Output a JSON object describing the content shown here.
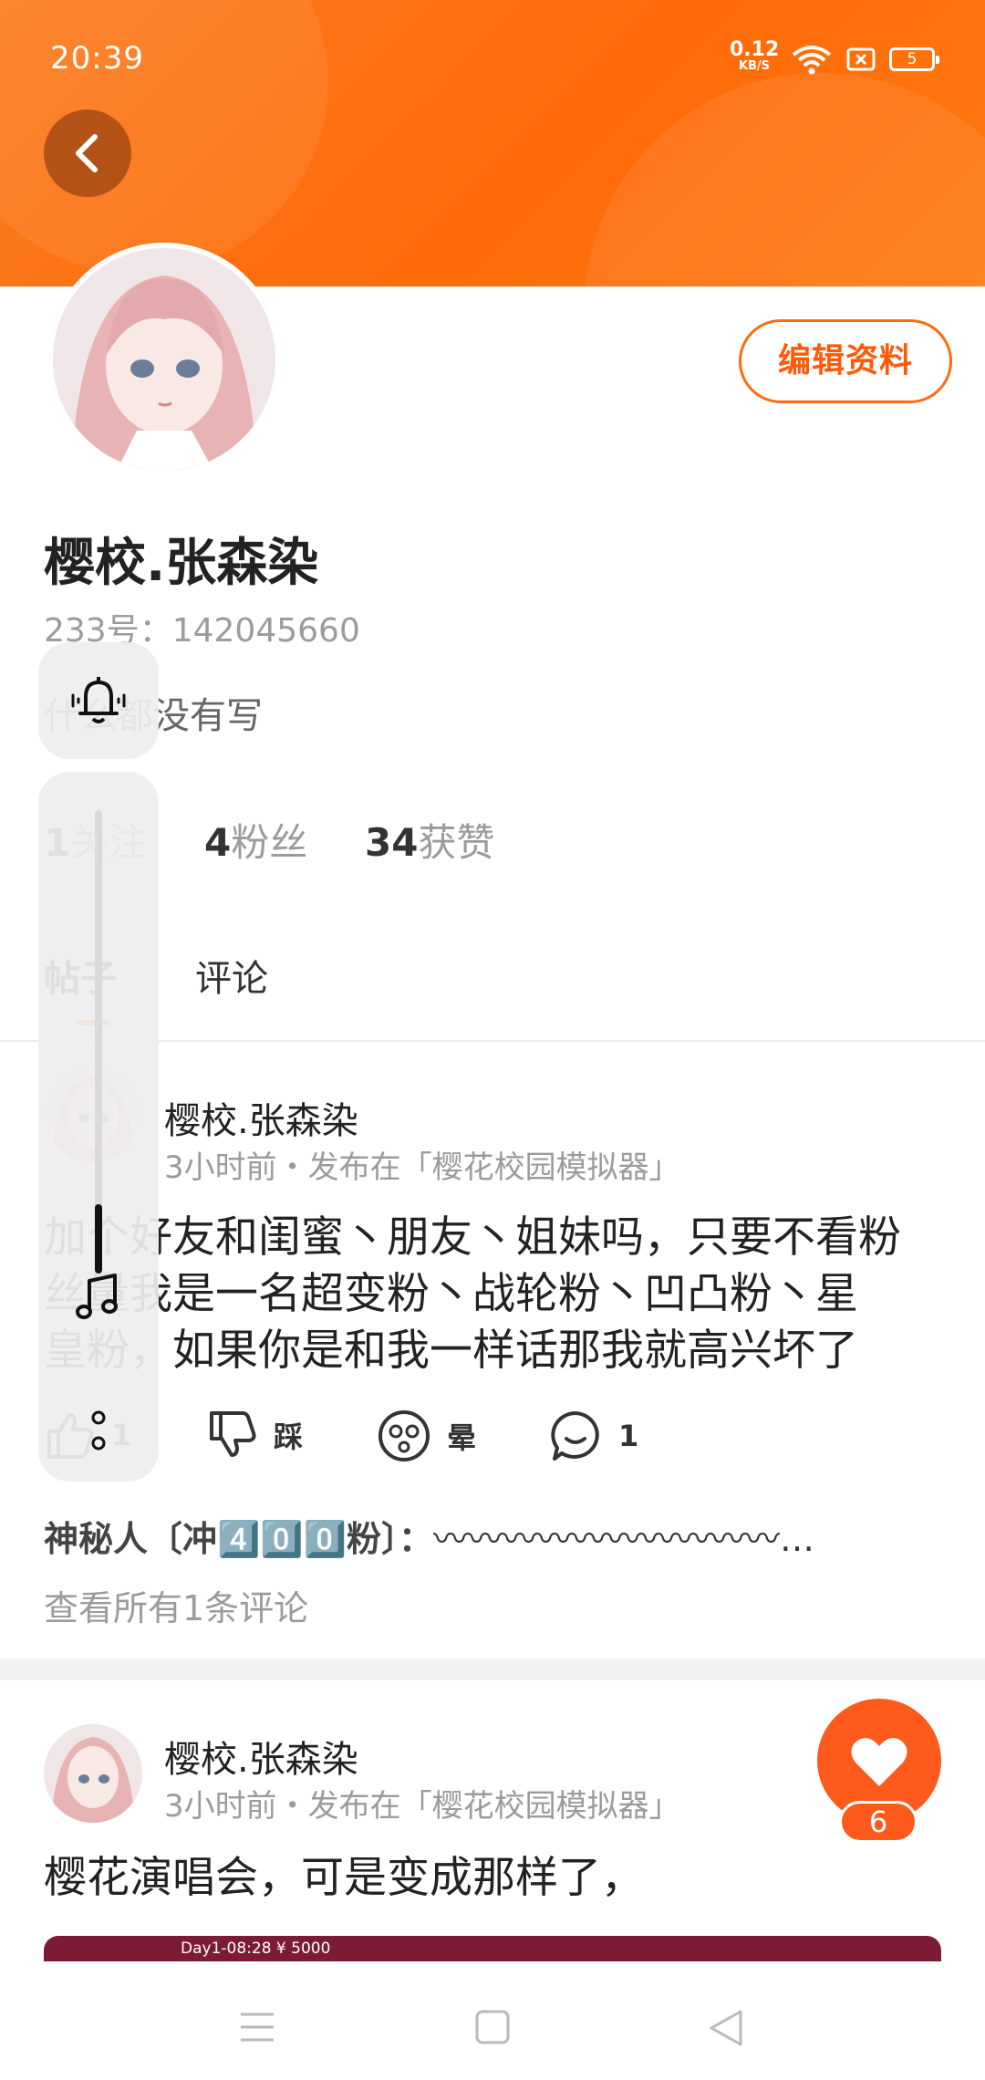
{
  "status_bar": {
    "time": "20:39",
    "net_speed_value": "0.12",
    "net_speed_unit": "KB/S",
    "battery": "5"
  },
  "profile": {
    "name": "樱校.张森染",
    "id_text": "233号：142045660",
    "bio": "什么都没有写",
    "edit_button": "编辑资料",
    "stats": {
      "following_count": "1",
      "following_label": "关注",
      "fans_count": "4",
      "fans_label": "粉丝",
      "likes_count": "34",
      "likes_label": "获赞"
    }
  },
  "tabs": [
    {
      "label": "帖子",
      "active": true
    },
    {
      "label": "评论",
      "active": false
    }
  ],
  "posts": [
    {
      "author": "樱校.张森染",
      "meta": "3小时前・发布在「樱花校园模拟器」",
      "lines": [
        "加个好友和闺蜜丶朋友丶姐妹吗，只要不看粉",
        "丝量我是一名超变粉丶战轮粉丶凹凸粉丶星",
        "皇粉，如果你是和我一样话那我就高兴坏了"
      ],
      "actions": {
        "like_count": "1",
        "dislike_label": "踩",
        "dizzy_label": "晕",
        "comment_count": "1"
      },
      "top_comment": {
        "user": "神秘人〔冲4️⃣0️⃣0️⃣粉〕",
        "separator": "：",
        "text": "〰〰〰〰〰〰〰〰〰〰…"
      },
      "view_all": "查看所有1条评论"
    },
    {
      "author": "樱校.张森染",
      "meta": "3小时前・发布在「樱花校园模拟器」",
      "text": "樱花演唱会，可是变成那样了，",
      "image_hud": "Day1-08:28 ¥ 5000"
    }
  ],
  "like_fab": {
    "count": "6"
  },
  "volume": {
    "level": 0.15
  },
  "colors": {
    "accent": "#ff6a10",
    "header": "#fb7d20",
    "fab": "#fe5a1c"
  }
}
